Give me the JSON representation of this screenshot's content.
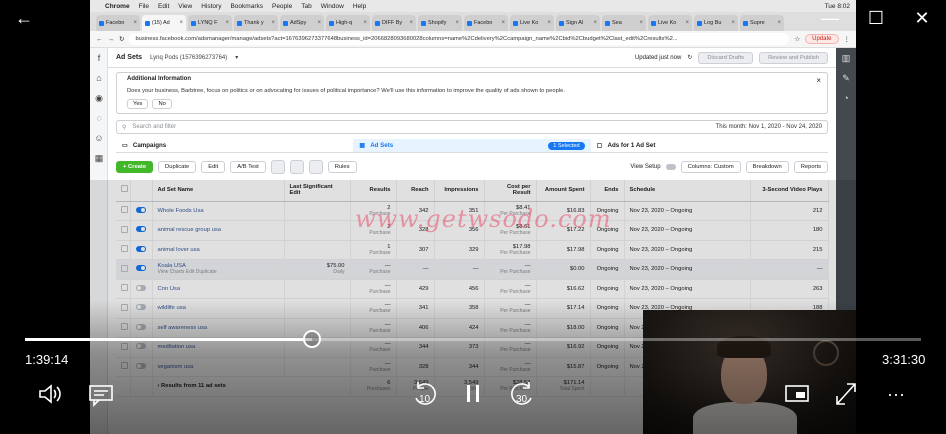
{
  "menubar": {
    "items": [
      "Chrome",
      "File",
      "Edit",
      "View",
      "History",
      "Bookmarks",
      "People",
      "Tab",
      "Window",
      "Help"
    ],
    "clock": "Tue 8:02"
  },
  "tabs": [
    {
      "label": "Facebo",
      "active": false
    },
    {
      "label": "(15) Ad",
      "active": true
    },
    {
      "label": "LYNQ F",
      "active": false
    },
    {
      "label": "Thank y",
      "active": false
    },
    {
      "label": "AdSpy",
      "active": false
    },
    {
      "label": "High-q",
      "active": false
    },
    {
      "label": "DIFF By",
      "active": false
    },
    {
      "label": "Shopify",
      "active": false
    },
    {
      "label": "Facebo",
      "active": false
    },
    {
      "label": "Live Ko",
      "active": false
    },
    {
      "label": "Sign Al",
      "active": false
    },
    {
      "label": "Sea",
      "active": false
    },
    {
      "label": "Live Ko",
      "active": false
    },
    {
      "label": "Log Bu",
      "active": false
    },
    {
      "label": "Supre",
      "active": false
    }
  ],
  "address": {
    "url": "business.facebook.com/adsmanager/manage/adsets?act=1676396273377648business_id=2066828093680028columns=name%2Cdelivery%2Ccampaign_name%2Cbid%2Cbudget%2Clast_edit%2Cresults%2...",
    "update_label": "Update"
  },
  "ads": {
    "header_title": "Ad Sets",
    "account": "Lynq Pods (1576396273764)",
    "updated": "Updated just now",
    "discard_label": "Discard Drafts",
    "review_label": "Review and Publish",
    "info_title": "Additional Information",
    "info_body": "Does your business, Barbtree, focus on politics or on advocating for issues of political importance? We'll use this information to improve the quality of ads shown to people.",
    "yes_label": "Yes",
    "no_label": "No",
    "search_placeholder": "Search and filter",
    "date_range": "This month: Nov 1, 2020 - Nov 24, 2020",
    "level_campaigns": "Campaigns",
    "level_adsets": "Ad Sets",
    "selected_pill": "1 Selected",
    "level_ads": "Ads for 1 Ad Set",
    "create_label": "Create",
    "duplicate_label": "Duplicate",
    "edit_label": "Edit",
    "ab_test_label": "A/B Test",
    "rules_label": "Rules",
    "view_setup_label": "View Setup",
    "columns_label": "Columns: Custom",
    "breakdown_label": "Breakdown",
    "reports_label": "Reports"
  },
  "table": {
    "headers": [
      "Ad Set Name",
      "Last Significant Edit",
      "Results",
      "Reach",
      "Impressions",
      "Cost per Result",
      "Amount Spent",
      "Ends",
      "Schedule",
      "3-Second Video Plays"
    ],
    "rows": [
      {
        "name": "Whole Foods Usa",
        "on": true,
        "results": "2",
        "results_sub": "Purchase",
        "reach": "342",
        "impressions": "351",
        "cpr": "$8.41",
        "cpr_sub": "Per Purchase",
        "spent": "$16.83",
        "ends": "Ongoing",
        "schedule": "Nov 23, 2020 – Ongoing",
        "plays": "212"
      },
      {
        "name": "animal rescue group usa",
        "on": true,
        "results": "2",
        "results_sub": "Purchase",
        "reach": "328",
        "impressions": "356",
        "cpr": "$8.61",
        "cpr_sub": "Per Purchase",
        "spent": "$17.22",
        "ends": "Ongoing",
        "schedule": "Nov 23, 2020 – Ongoing",
        "plays": "180"
      },
      {
        "name": "animal lover usa",
        "on": true,
        "results": "1",
        "results_sub": "Purchase",
        "reach": "307",
        "impressions": "329",
        "cpr": "$17.98",
        "cpr_sub": "Per Purchase",
        "spent": "$17.98",
        "ends": "Ongoing",
        "schedule": "Nov 23, 2020 – Ongoing",
        "plays": "215"
      },
      {
        "name": "Koala USA",
        "on": true,
        "results": "—",
        "results_sub": "Purchase",
        "reach": "—",
        "impressions": "—",
        "cpr": "—",
        "cpr_sub": "Per Purchase",
        "spent": "$0.00",
        "ends": "Ongoing",
        "schedule": "Nov 23, 2020 – Ongoing",
        "plays": "—",
        "budget": "$75.00",
        "budget_sub": "Daily",
        "row_actions": "View Charts  Edit  Duplicate"
      },
      {
        "name": "Cnn Usa",
        "on": false,
        "results": "—",
        "results_sub": "Purchase",
        "reach": "429",
        "impressions": "456",
        "cpr": "—",
        "cpr_sub": "Per Purchase",
        "spent": "$16.62",
        "ends": "Ongoing",
        "schedule": "Nov 23, 2020 – Ongoing",
        "plays": "263"
      },
      {
        "name": "wildlife usa",
        "on": false,
        "results": "—",
        "results_sub": "Purchase",
        "reach": "341",
        "impressions": "358",
        "cpr": "—",
        "cpr_sub": "Per Purchase",
        "spent": "$17.14",
        "ends": "Ongoing",
        "schedule": "Nov 23, 2020 – Ongoing",
        "plays": "188"
      },
      {
        "name": "self awareness usa",
        "on": false,
        "results": "—",
        "results_sub": "Purchase",
        "reach": "406",
        "impressions": "424",
        "cpr": "—",
        "cpr_sub": "Per Purchase",
        "spent": "$18.00",
        "ends": "Ongoing",
        "schedule": "Nov 23, 2020 – Ongoing",
        "plays": ""
      },
      {
        "name": "meditation usa",
        "on": false,
        "results": "—",
        "results_sub": "Purchase",
        "reach": "344",
        "impressions": "373",
        "cpr": "—",
        "cpr_sub": "Per Purchase",
        "spent": "$16.92",
        "ends": "Ongoing",
        "schedule": "Nov 23, 2020 – Ongoing",
        "plays": ""
      },
      {
        "name": "veganism usa",
        "on": false,
        "results": "—",
        "results_sub": "Purchase",
        "reach": "328",
        "impressions": "344",
        "cpr": "—",
        "cpr_sub": "Per Purchase",
        "spent": "$15.87",
        "ends": "Ongoing",
        "schedule": "Nov 23, 2020 – Ongoing",
        "plays": ""
      }
    ],
    "footer": {
      "label": "Results from 11 ad sets",
      "results": "6",
      "results_sub": "Purchases",
      "reach": "3,649",
      "reach_sub": "People",
      "impressions": "3,549",
      "impressions_sub": "Total",
      "cpr": "$28.53",
      "cpr_sub": "Per Purchase",
      "spent": "$171.14",
      "spent_sub": "Total Spent"
    }
  },
  "watermark": "www.getwsodo.com",
  "player": {
    "elapsed": "1:39:14",
    "total": "3:31:30",
    "progress": 0.32,
    "skip_back_label": "10",
    "skip_forward_label": "30"
  }
}
